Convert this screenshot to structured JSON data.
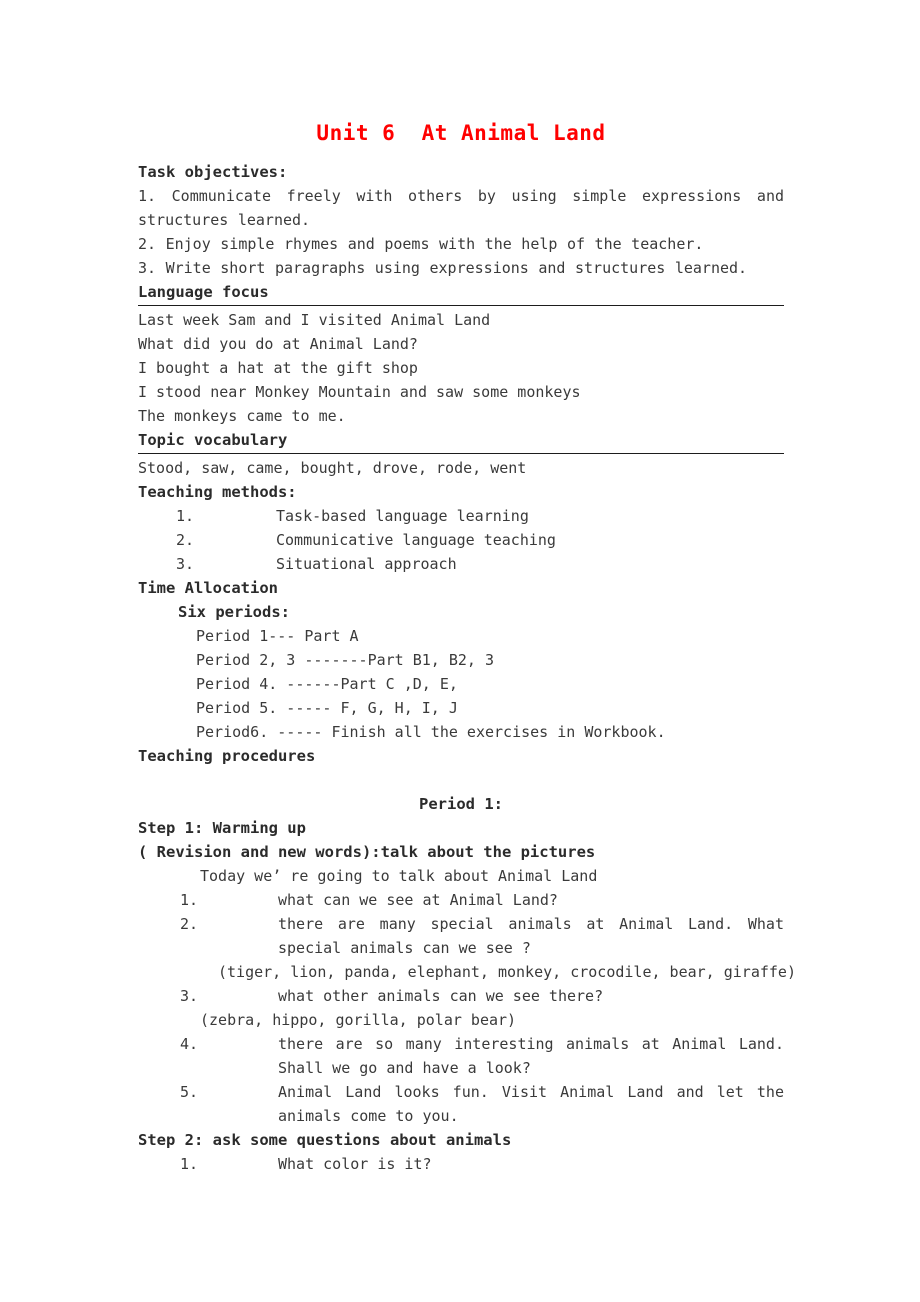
{
  "title": "Unit 6  At Animal Land",
  "accent_color": "#ff0000",
  "sections": {
    "task_objectives": {
      "heading": "Task objectives:",
      "items": [
        "1. Communicate freely with others by using simple expressions and structures learned.",
        "2. Enjoy simple rhymes and poems with the help of the teacher.",
        "3. Write short paragraphs using expressions and structures learned."
      ]
    },
    "language_focus": {
      "heading": "Language focus",
      "lines": [
        "Last week Sam and I visited Animal Land",
        "What did you do at Animal Land?",
        "I bought a hat at the gift shop",
        "I stood near Monkey Mountain and saw some monkeys",
        "The monkeys came to me."
      ]
    },
    "topic_vocabulary": {
      "heading": "Topic vocabulary",
      "words": "Stood, saw, came, bought, drove, rode, went"
    },
    "teaching_methods": {
      "heading": "Teaching methods:",
      "items": [
        {
          "marker": "1.",
          "text": "Task-based language learning"
        },
        {
          "marker": "2.",
          "text": "Communicative language teaching"
        },
        {
          "marker": "3.",
          "text": "Situational approach"
        }
      ]
    },
    "time_allocation": {
      "heading": "Time Allocation",
      "subheading": "Six periods:",
      "periods": [
        "Period 1--- Part A",
        "Period 2, 3 -------Part B1, B2, 3",
        "Period 4. ------Part C ,D, E,",
        "Period 5. ----- F, G, H, I, J",
        "Period6. ----- Finish all the exercises in Workbook."
      ]
    },
    "teaching_procedures": {
      "heading": "Teaching procedures",
      "period_heading": "Period 1:",
      "step1": {
        "heading": "Step 1: Warming up",
        "subheading": "( Revision and new words):talk about the pictures",
        "intro": "Today we’ re going to talk about Animal Land",
        "items": [
          {
            "marker": "1.",
            "text": "what can we see at Animal Land?"
          },
          {
            "marker": "2.",
            "text": "there are many special animals at Animal Land. What special animals can we see ?"
          }
        ],
        "animals_1": "(tiger, lion, panda, elephant, monkey, crocodile, bear, giraffe)",
        "item3": {
          "marker": "3.",
          "text": "what other animals can we see there?"
        },
        "animals_2": "(zebra, hippo, gorilla, polar bear)",
        "item4": {
          "marker": "4.",
          "text": "there are so many interesting animals at Animal Land. Shall we go and have a look?"
        },
        "item5": {
          "marker": "5.",
          "text": "Animal Land looks fun. Visit Animal Land and let the animals come to you."
        }
      },
      "step2": {
        "heading": "Step 2: ask some questions about animals",
        "items": [
          {
            "marker": "1.",
            "text": "What color is it?"
          }
        ]
      }
    }
  }
}
